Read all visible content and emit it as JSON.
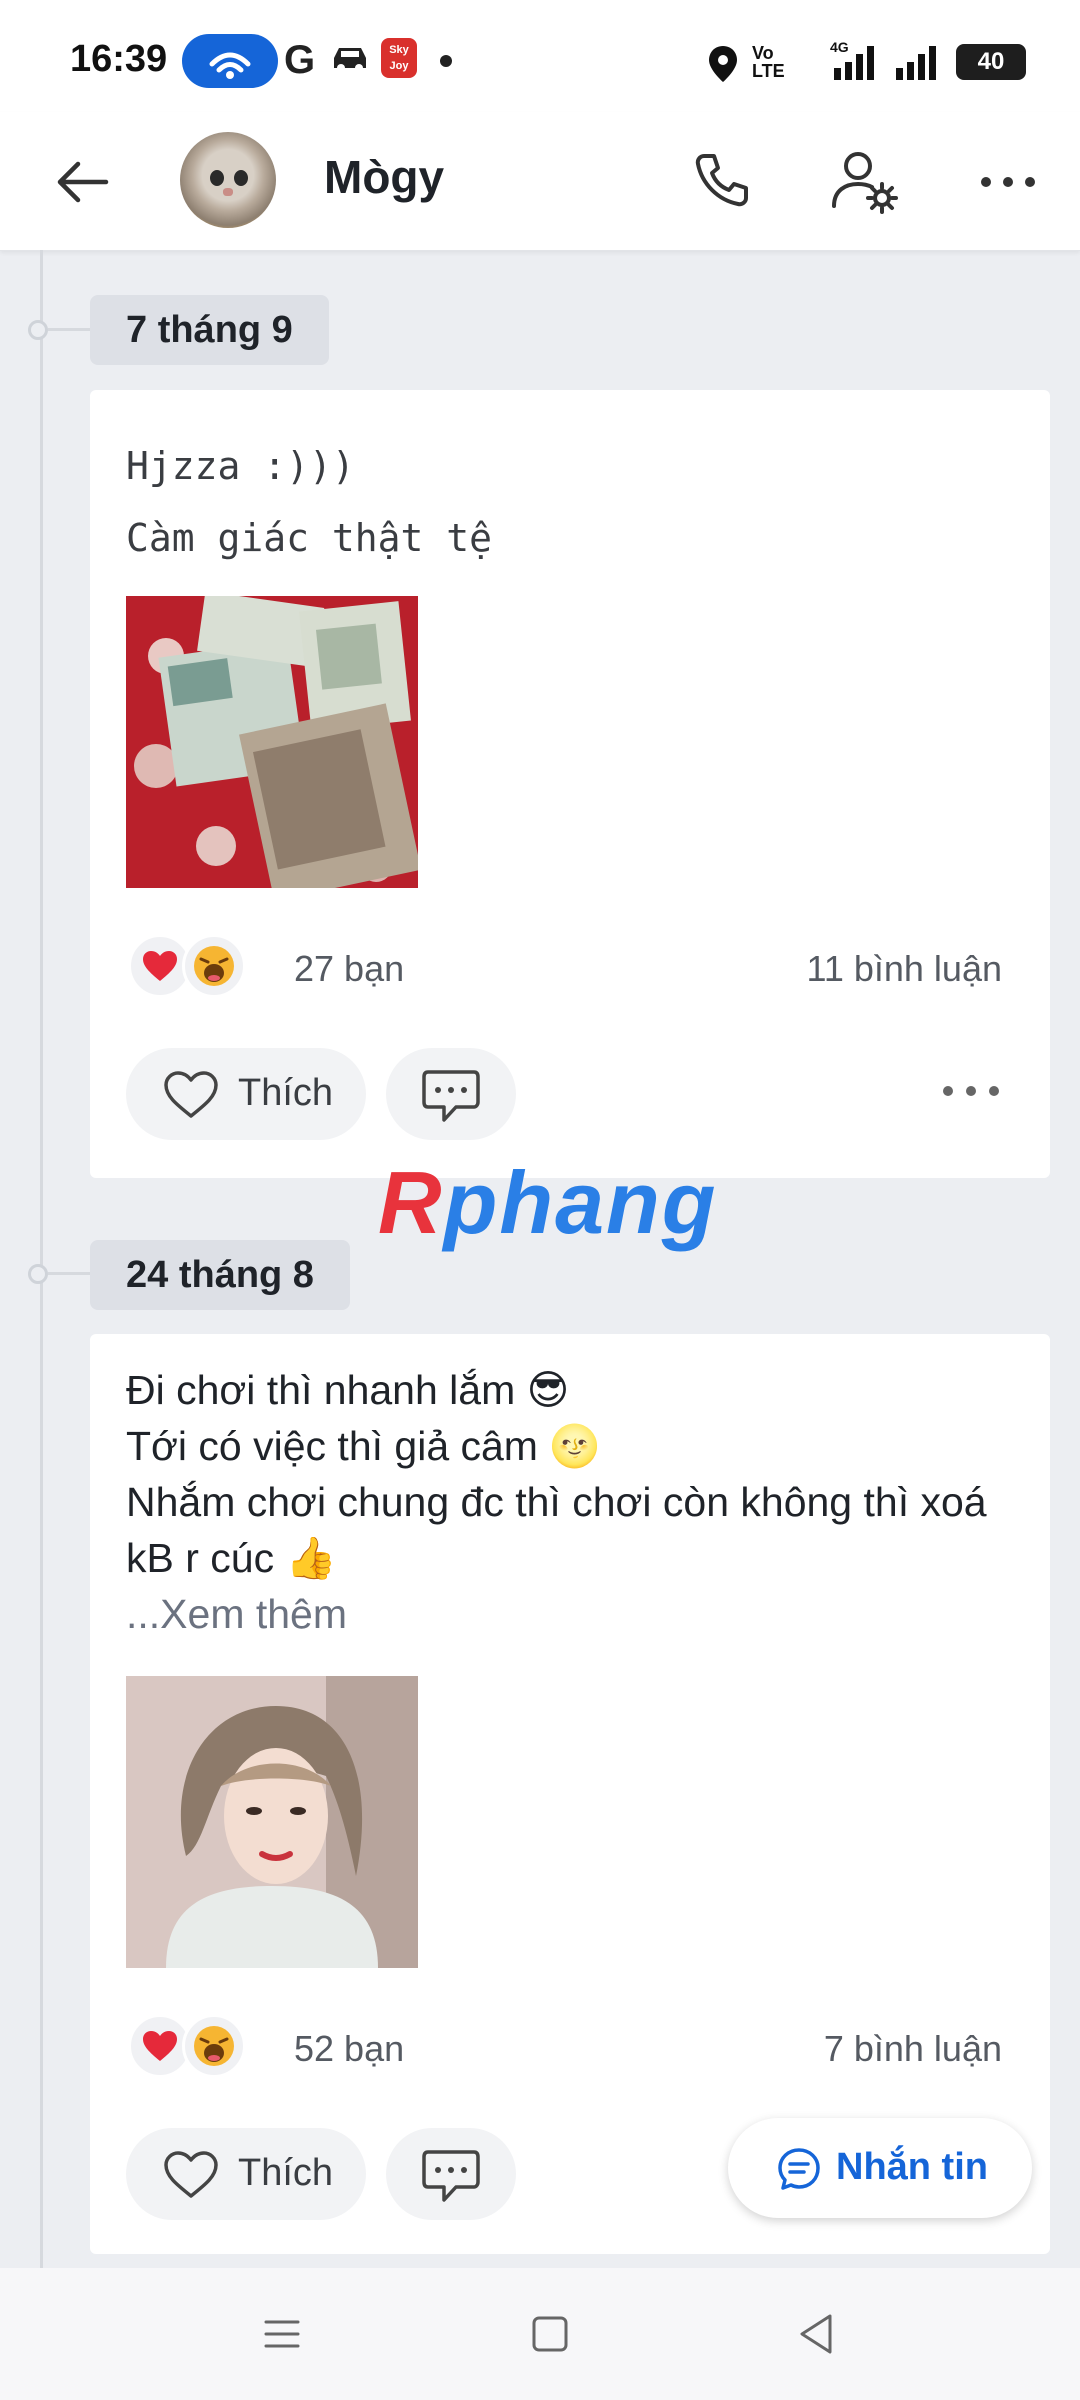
{
  "status_bar": {
    "time": "16:39",
    "battery": "40",
    "volte_line1": "Vo",
    "volte_line2": "LTE",
    "network": "4G",
    "sky_badge": "Sky Joy",
    "icons": [
      "hotspot-icon",
      "g-icon",
      "car-icon",
      "skyjoy-icon",
      "location-icon",
      "signal-icon",
      "battery-icon"
    ]
  },
  "header": {
    "contact_name": "Mògy",
    "icons": [
      "back-arrow-icon",
      "phone-icon",
      "user-settings-icon",
      "more-icon"
    ]
  },
  "posts": [
    {
      "date": "7 tháng 9",
      "text_lines": [
        "Hjzza :)))",
        "Càm giác thật tệ"
      ],
      "image": "banknotes-photo",
      "reaction_count": "27 bạn",
      "comment_count": "11 bình luận",
      "like_label": "Thích"
    },
    {
      "date": "24 tháng 8",
      "text_lines": [
        "Đi chơi thì nhanh lắm 😎",
        "Tới có việc thì giả câm 🌝",
        "Nhắm chơi chung đc thì chơi còn không thì xoá kB r cúc 👍"
      ],
      "see_more": "...Xem thêm",
      "image": "portrait-photo",
      "reaction_count": "52 bạn",
      "comment_count": "7 bình luận",
      "like_label": "Thích"
    }
  ],
  "watermark": {
    "first": "R",
    "rest": "phang"
  },
  "message_button": {
    "label": "Nhắn tin"
  },
  "colors": {
    "accent": "#1565d8",
    "background": "#eceef2",
    "card": "#ffffff",
    "heart": "#e5293a"
  }
}
